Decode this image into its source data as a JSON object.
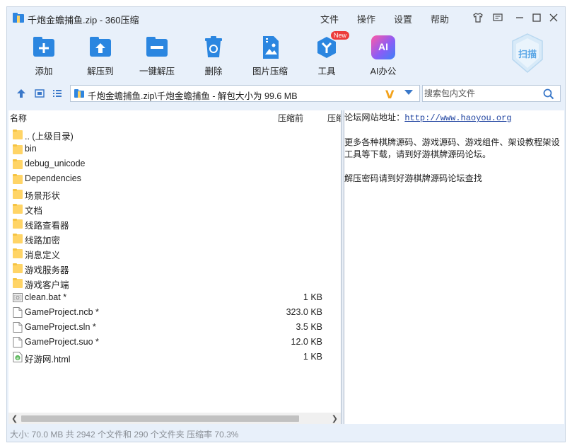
{
  "titlebar": {
    "title": "千炮金蟾捕鱼.zip - 360压缩",
    "menus": [
      "文件",
      "操作",
      "设置",
      "帮助"
    ]
  },
  "toolbar": {
    "buttons": [
      {
        "label": "添加",
        "icon": "add-icon"
      },
      {
        "label": "解压到",
        "icon": "extract-to-icon"
      },
      {
        "label": "一键解压",
        "icon": "one-click-extract-icon"
      },
      {
        "label": "删除",
        "icon": "trash-icon"
      },
      {
        "label": "图片压缩",
        "icon": "image-compress-icon"
      },
      {
        "label": "工具",
        "icon": "tools-icon"
      },
      {
        "label": "AI办公",
        "icon": "ai-icon"
      }
    ],
    "new_badge": "New",
    "scan_label": "扫描",
    "ai_icon_text": "AI"
  },
  "nav": {
    "path": "千炮金蟾捕鱼.zip\\千炮金蟾捕鱼 - 解包大小为 99.6 MB",
    "search_placeholder": "搜索包内文件"
  },
  "columns": {
    "name": "名称",
    "before": "压缩前",
    "after": "压缩"
  },
  "files": [
    {
      "name": ".. (上级目录)",
      "size": "",
      "type": "folder"
    },
    {
      "name": "bin",
      "size": "",
      "type": "folder"
    },
    {
      "name": "debug_unicode",
      "size": "",
      "type": "folder"
    },
    {
      "name": "Dependencies",
      "size": "",
      "type": "folder"
    },
    {
      "name": "场景形状",
      "size": "",
      "type": "folder"
    },
    {
      "name": "文档",
      "size": "",
      "type": "folder"
    },
    {
      "name": "线路查看器",
      "size": "",
      "type": "folder"
    },
    {
      "name": "线路加密",
      "size": "",
      "type": "folder"
    },
    {
      "name": "消息定义",
      "size": "",
      "type": "folder"
    },
    {
      "name": "游戏服务器",
      "size": "",
      "type": "folder"
    },
    {
      "name": "游戏客户端",
      "size": "",
      "type": "folder"
    },
    {
      "name": "clean.bat *",
      "size": "1 KB",
      "type": "bat"
    },
    {
      "name": "GameProject.ncb *",
      "size": "323.0 KB",
      "type": "file"
    },
    {
      "name": "GameProject.sln *",
      "size": "3.5 KB",
      "type": "file"
    },
    {
      "name": "GameProject.suo *",
      "size": "12.0 KB",
      "type": "file"
    },
    {
      "name": "好游网.html",
      "size": "1 KB",
      "type": "html"
    }
  ],
  "preview": {
    "forum_label": "论坛网站地址：",
    "forum_url": "http://www.haoyou.org",
    "line2": "更多各种棋牌源码、游戏源码、游戏组件、架设教程架设工具等下载，请到好游棋牌源码论坛。",
    "line3": "解压密码请到好游棋牌源码论坛查找"
  },
  "status": "大小: 70.0 MB 共 2942 个文件和 290 个文件夹 压缩率 70.3%",
  "colors": {
    "accent": "#2b86e0",
    "window_bg": "#e8f0fa",
    "folder": "#ffd466",
    "link": "#1a3f9e"
  }
}
